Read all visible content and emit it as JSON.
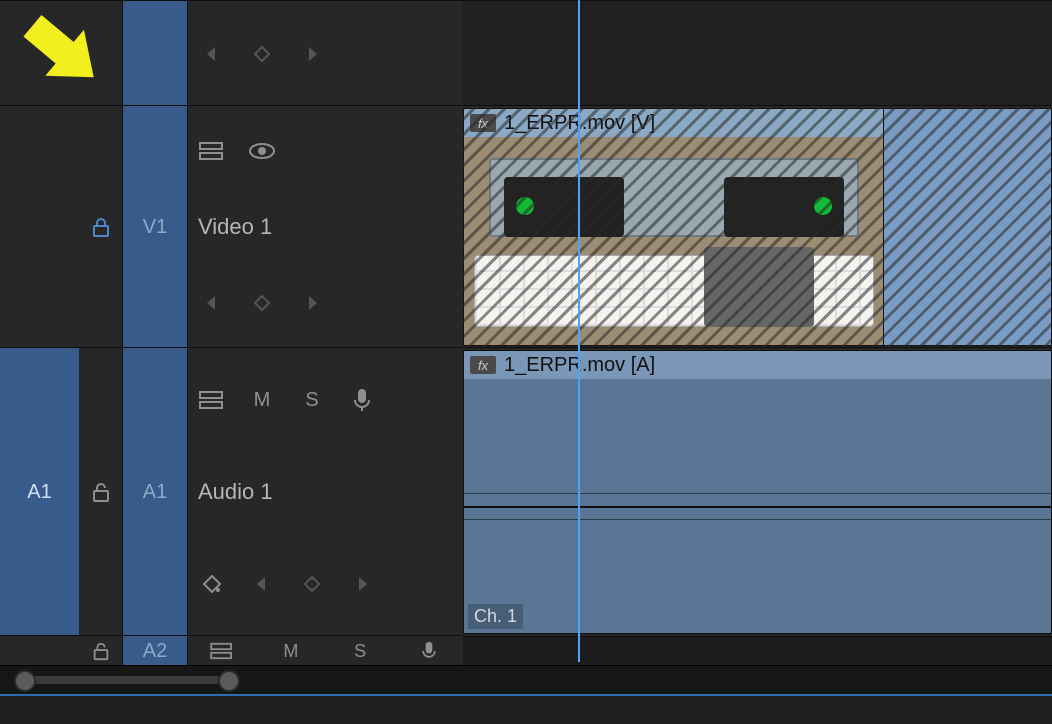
{
  "tracks": {
    "v2": {
      "target_label": "",
      "name": ""
    },
    "v1": {
      "target_label": "V1",
      "name": "Video 1",
      "locked": true
    },
    "a1": {
      "source_label": "A1",
      "target_label": "A1",
      "name": "Audio 1",
      "mute_label": "M",
      "solo_label": "S",
      "channel_label": "Ch. 1"
    },
    "a2": {
      "target_label": "A2",
      "mute_label": "M",
      "solo_label": "S"
    }
  },
  "clips": {
    "video": {
      "fx_label": "fx",
      "name": "1_ERPR.mov [V]"
    },
    "audio": {
      "fx_label": "fx",
      "name": "1_ERPR.mov [A]"
    }
  },
  "icons": {
    "lock": "lock-icon",
    "unlock": "unlock-icon",
    "eye": "eye-icon",
    "mic": "mic-icon",
    "stack": "stack-icon",
    "keyframe": "keyframe-icon"
  }
}
